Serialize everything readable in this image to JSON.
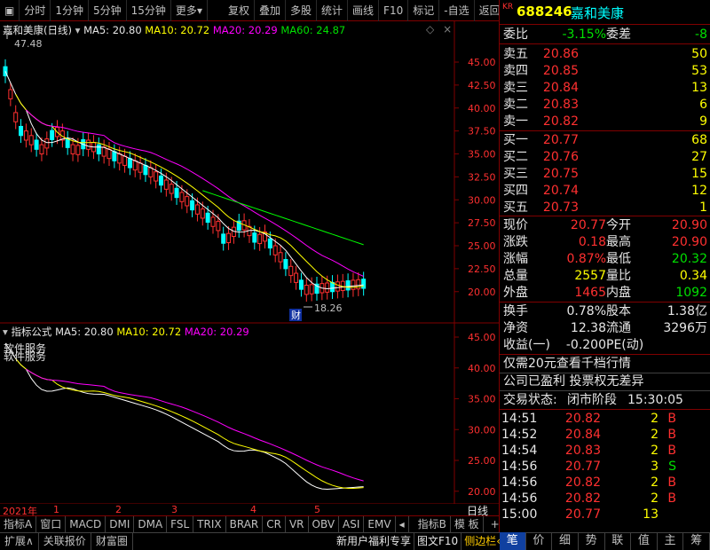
{
  "toolbar": {
    "items": [
      "分时",
      "1分钟",
      "5分钟",
      "15分钟",
      "更多",
      "复权",
      "叠加",
      "多股",
      "统计",
      "画线",
      "F10",
      "标记",
      "-自选",
      "返回"
    ]
  },
  "main_chart": {
    "title": "嘉和美康(日线)",
    "ma5": "MA5: 20.80",
    "ma10": "MA10: 20.72",
    "ma20": "MA20: 20.29",
    "ma60": "MA60: 24.87",
    "high_label": "47.48",
    "low_label": "18.26",
    "badge": "财",
    "y_ticks": [
      "45.00",
      "42.50",
      "40.00",
      "37.50",
      "35.00",
      "32.50",
      "30.00",
      "27.50",
      "25.00",
      "22.50",
      "20.00"
    ]
  },
  "sub_chart": {
    "title": "指标公式",
    "ma5": "MA5: 20.80",
    "ma10": "MA10: 20.72",
    "ma20": "MA20: 20.29",
    "overlay_text": "软件服务",
    "y_ticks": [
      "45.00",
      "40.00",
      "35.00",
      "30.00",
      "25.00",
      "20.00"
    ]
  },
  "x_axis": {
    "labels": [
      "2021年",
      "1",
      "2",
      "3",
      "4",
      "5"
    ],
    "right_label": "日线"
  },
  "indicator_tabs": [
    "指标A",
    "窗口",
    "MACD",
    "DMI",
    "DMA",
    "FSL",
    "TRIX",
    "BRAR",
    "CR",
    "VR",
    "OBV",
    "ASI",
    "EMV"
  ],
  "indicator_tabs_right": [
    "指标B",
    "模 板",
    "+",
    "-"
  ],
  "status_bar": [
    "扩展∧",
    "关联报价",
    "财富圈"
  ],
  "status_bar_right": [
    "新用户福利专享",
    "图文F10",
    "侧边栏"
  ],
  "right_tabs": [
    "笔",
    "价",
    "细",
    "势",
    "联",
    "值",
    "主",
    "筹"
  ],
  "quote": {
    "code": "688246",
    "name": "嘉和美康",
    "prefix": "KR",
    "webi_label": "委比",
    "webi": "-3.15%",
    "weicha_label": "委差",
    "weicha": "-8",
    "asks": [
      {
        "label": "卖五",
        "price": "20.86",
        "vol": "50"
      },
      {
        "label": "卖四",
        "price": "20.85",
        "vol": "53"
      },
      {
        "label": "卖三",
        "price": "20.84",
        "vol": "13"
      },
      {
        "label": "卖二",
        "price": "20.83",
        "vol": "6"
      },
      {
        "label": "卖一",
        "price": "20.82",
        "vol": "9"
      }
    ],
    "bids": [
      {
        "label": "买一",
        "price": "20.77",
        "vol": "68"
      },
      {
        "label": "买二",
        "price": "20.76",
        "vol": "27"
      },
      {
        "label": "买三",
        "price": "20.75",
        "vol": "15"
      },
      {
        "label": "买四",
        "price": "20.74",
        "vol": "12"
      },
      {
        "label": "买五",
        "price": "20.73",
        "vol": "1"
      }
    ],
    "stats": [
      {
        "l1": "现价",
        "v1": "20.77",
        "c1": "red",
        "l2": "今开",
        "v2": "20.90",
        "c2": "red"
      },
      {
        "l1": "涨跌",
        "v1": "0.18",
        "c1": "red",
        "l2": "最高",
        "v2": "20.90",
        "c2": "red"
      },
      {
        "l1": "涨幅",
        "v1": "0.87%",
        "c1": "red",
        "l2": "最低",
        "v2": "20.32",
        "c2": "green"
      },
      {
        "l1": "总量",
        "v1": "2557",
        "c1": "yellow",
        "l2": "量比",
        "v2": "0.34",
        "c2": "yellow"
      },
      {
        "l1": "外盘",
        "v1": "1465",
        "c1": "red",
        "l2": "内盘",
        "v2": "1092",
        "c2": "green"
      }
    ],
    "stats2": [
      {
        "l1": "换手",
        "v1": "0.78%",
        "l2": "股本",
        "v2": "1.38亿"
      },
      {
        "l1": "净资",
        "v1": "12.38",
        "l2": "流通",
        "v2": "3296万"
      },
      {
        "l1": "收益(一)",
        "v1": "-0.200",
        "l2": "PE(动)",
        "v2": ""
      }
    ],
    "notice1": "仅需20元查看千档行情",
    "notice2": "公司已盈利 投票权无差异",
    "trade_state_label": "交易状态:",
    "trade_state": "闭市阶段",
    "trade_time": "15:30:05",
    "ticks": [
      {
        "t": "14:51",
        "p": "20.82",
        "v": "2",
        "d": "B"
      },
      {
        "t": "14:52",
        "p": "20.84",
        "v": "2",
        "d": "B"
      },
      {
        "t": "14:54",
        "p": "20.83",
        "v": "2",
        "d": "B"
      },
      {
        "t": "14:56",
        "p": "20.77",
        "v": "3",
        "d": "S"
      },
      {
        "t": "14:56",
        "p": "20.82",
        "v": "2",
        "d": "B"
      },
      {
        "t": "14:56",
        "p": "20.82",
        "v": "2",
        "d": "B"
      },
      {
        "t": "15:00",
        "p": "20.77",
        "v": "13",
        "d": ""
      }
    ]
  },
  "colors": {
    "up": "#ff3030",
    "down": "#00ffff",
    "ma5": "#ffffff",
    "ma10": "#ffff00",
    "ma20": "#ff00ff",
    "ma60": "#00ff00"
  }
}
